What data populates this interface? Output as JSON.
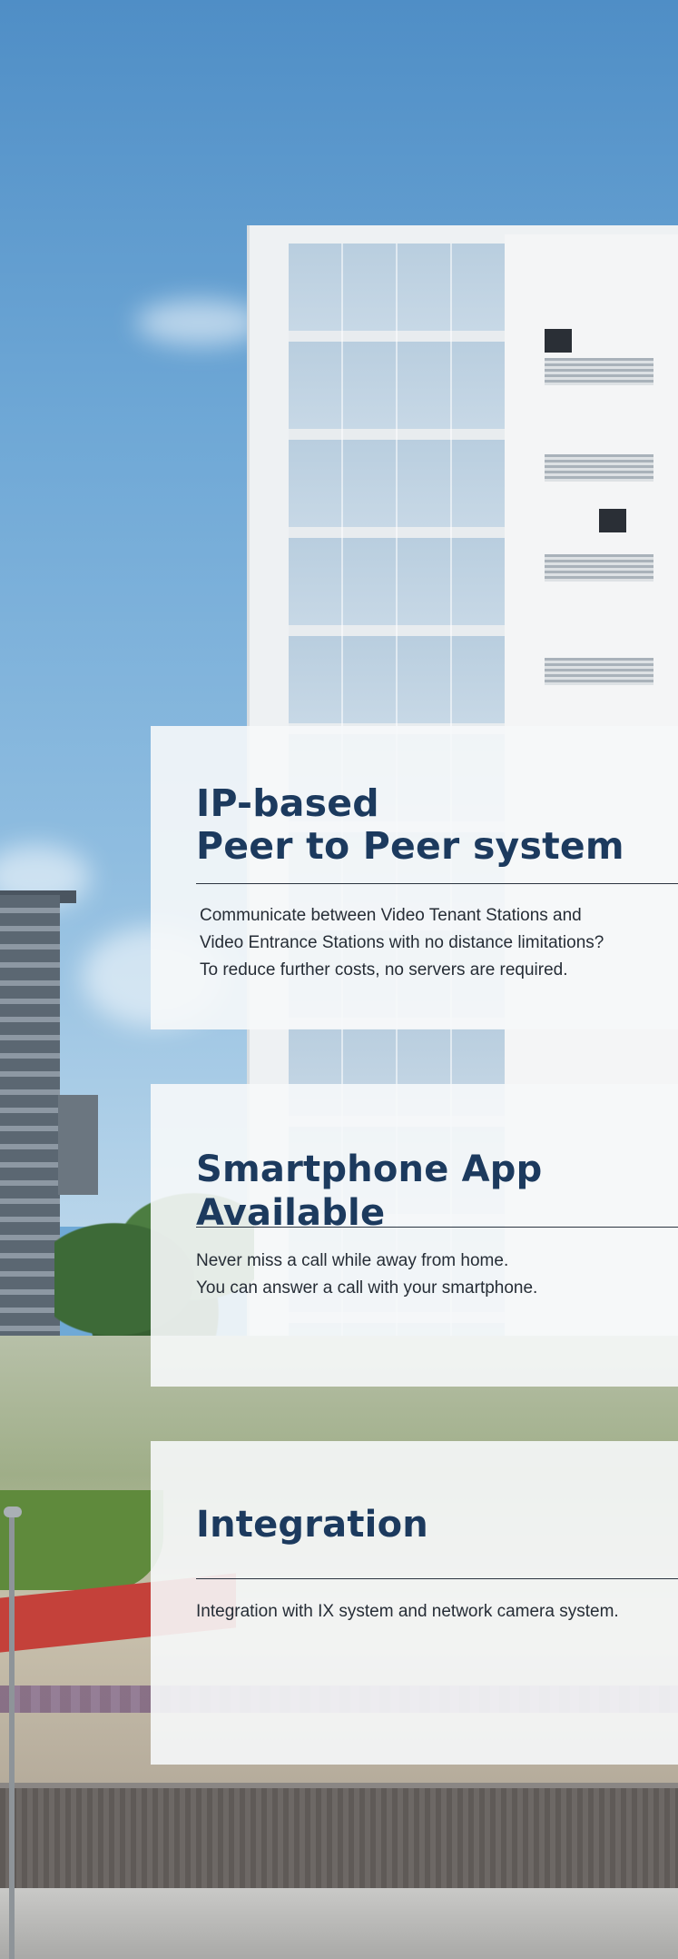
{
  "sections": [
    {
      "title": "IP-based\nPeer to Peer system",
      "lines": [
        "Communicate  between Video Tenant Stations and",
        "Video Entrance Stations with no distance limitations?",
        "To reduce further costs, no servers are required."
      ]
    },
    {
      "title": "Smartphone App Available",
      "lines": [
        "Never miss a call while away from home.",
        "You can answer a call with your smartphone."
      ]
    },
    {
      "title": "Integration",
      "lines": [
        "Integration with IX system and network camera system."
      ]
    }
  ],
  "colors": {
    "title": "#1c3a5e",
    "body_text": "#262d36",
    "panel_background": "#f6f8fa",
    "rule": "#2b3440"
  }
}
